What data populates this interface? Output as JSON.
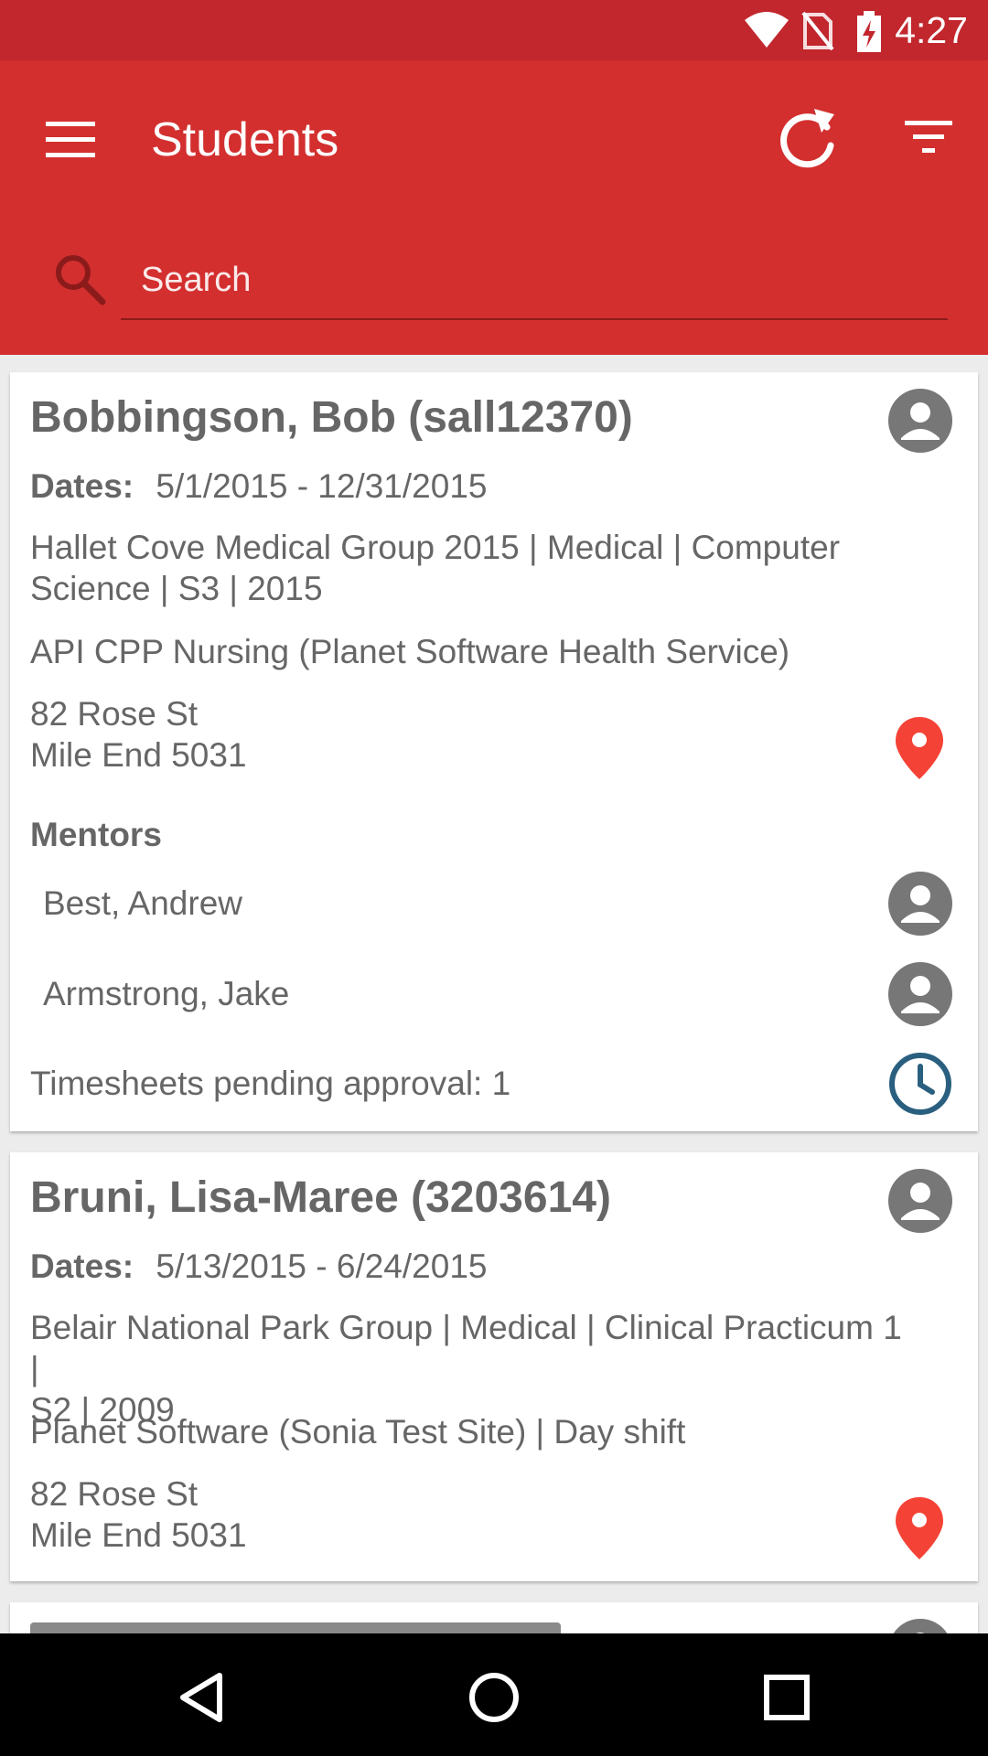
{
  "status_bar": {
    "time": "4:27"
  },
  "app_bar": {
    "title": "Students"
  },
  "search": {
    "placeholder": "Search"
  },
  "students": [
    {
      "name": "Bobbingson, Bob (sall12370)",
      "dates_label": "Dates:",
      "dates": "5/1/2015 - 12/31/2015",
      "program_line1": "Hallet Cove Medical Group 2015 | Medical | Computer",
      "program_line2": "Science | S3 | 2015",
      "site": "API CPP Nursing (Planet Software Health Service)",
      "address_line1": "82 Rose St",
      "address_line2": "Mile End 5031",
      "mentors_heading": "Mentors",
      "mentors": [
        "Best, Andrew",
        "Armstrong, Jake"
      ],
      "timesheets": "Timesheets pending approval: 1"
    },
    {
      "name": "Bruni, Lisa-Maree (3203614)",
      "dates_label": "Dates:",
      "dates": "5/13/2015 - 6/24/2015",
      "program_line1": "Belair National Park Group | Medical | Clinical Practicum 1 |",
      "program_line2": "S2 | 2009",
      "site": "Planet Software (Sonia Test Site) | Day shift",
      "address_line1": "82 Rose St",
      "address_line2": "Mile End 5031"
    }
  ],
  "colors": {
    "status_bar": "#c1272d",
    "app_bar": "#d32f2f",
    "pin": "#f44336",
    "clock": "#2a5f80",
    "avatar": "#777777"
  },
  "icons": [
    "menu-icon",
    "refresh-icon",
    "filter-icon",
    "search-icon",
    "person-icon",
    "location-pin-icon",
    "clock-icon",
    "back-icon",
    "home-icon",
    "recents-icon"
  ]
}
